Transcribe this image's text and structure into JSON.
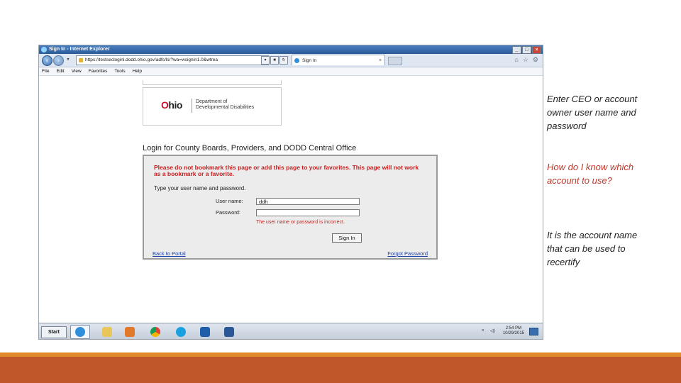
{
  "browser": {
    "window_title": "Sign In - Internet Explorer",
    "address": "https://testsecloginl.dodd.ohio.gov/adfs/ls/?wa=wsignin1.0&wtrea",
    "tab_title": "Sign In",
    "menu": [
      "File",
      "Edit",
      "View",
      "Favorites",
      "Tools",
      "Help"
    ]
  },
  "page": {
    "logo_word": "Ohio",
    "logo_dept_line1": "Department of",
    "logo_dept_line2": "Developmental Disabilities",
    "heading": "Login for County Boards, Providers, and DODD Central Office",
    "warning": "Please do not bookmark this page or add this page to your favorites. This page will not work as a bookmark or a favorite.",
    "instruction": "Type your user name and password.",
    "username_label": "User name:",
    "username_value": "ddh",
    "password_label": "Password:",
    "password_value": "",
    "error": "The user name or password is incorrect.",
    "signin_label": "Sign In",
    "back_link": "Back to Portal",
    "forgot_link": "Forgot Password"
  },
  "taskbar": {
    "start_label": "Start",
    "time": "2:54 PM",
    "date": "10/29/2015"
  },
  "notes": {
    "note1": "Enter CEO or account owner user name and password",
    "note2": "How do I know which account to use?",
    "note3": "It is the account name that can be used to recertify"
  },
  "colors": {
    "warning_red": "#c81e1e",
    "link_blue": "#1a3fa6",
    "footer_orange": "#e08a2a",
    "footer_rust": "#c0572a"
  }
}
